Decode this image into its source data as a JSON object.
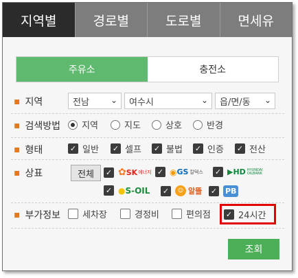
{
  "tabs": [
    {
      "label": "지역별",
      "active": true
    },
    {
      "label": "경로별",
      "active": false
    },
    {
      "label": "도로별",
      "active": false
    },
    {
      "label": "면세유",
      "active": false
    }
  ],
  "segments": [
    {
      "label": "주유소",
      "active": true
    },
    {
      "label": "충전소",
      "active": false
    }
  ],
  "region": {
    "label": "지역",
    "sido": "전남",
    "sigungu": "여수시",
    "eupmyeondong": "읍/면/동"
  },
  "search_method": {
    "label": "검색방법",
    "options": [
      {
        "label": "지역",
        "selected": true
      },
      {
        "label": "지도",
        "selected": false
      },
      {
        "label": "상호",
        "selected": false
      },
      {
        "label": "반경",
        "selected": false
      }
    ]
  },
  "type": {
    "label": "형태",
    "options": [
      {
        "label": "일반",
        "checked": true
      },
      {
        "label": "셀프",
        "checked": true
      },
      {
        "label": "불법",
        "checked": true
      },
      {
        "label": "인증",
        "checked": true
      },
      {
        "label": "전산",
        "checked": true
      }
    ]
  },
  "brand": {
    "label": "상표",
    "all_button": "전체",
    "logos": {
      "sk": "SK",
      "sk_sub": "에너지",
      "gs": "GS",
      "gs_sub": "칼텍스",
      "hd": "HD",
      "hd_sub": "HYUNDAI OILBANK",
      "soil": "S-OIL",
      "altteul": "알뜰",
      "pb": "PB"
    }
  },
  "extra": {
    "label": "부가정보",
    "options": [
      {
        "label": "세차장",
        "checked": false
      },
      {
        "label": "경정비",
        "checked": false
      },
      {
        "label": "편의점",
        "checked": false
      },
      {
        "label": "24시간",
        "checked": true
      }
    ]
  },
  "submit_label": "조회",
  "colors": {
    "tab_active": "#2b2b2b",
    "tab_inactive": "#7d7d7d",
    "segment_active": "#5fb96f",
    "submit": "#4caf57",
    "highlight": "#e00000",
    "bullet": "#e07b1f"
  }
}
